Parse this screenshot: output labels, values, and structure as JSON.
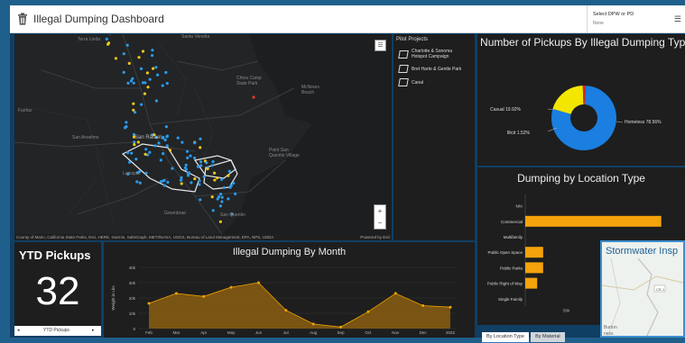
{
  "header": {
    "title": "Illegal Dumping Dashboard",
    "selector_label": "Select DPW or PD",
    "selector_value": "None",
    "menu_glyph": "☰"
  },
  "map": {
    "attribution": "County of Marin, California State Parks, Esri, HERE, Garmin, SafeGraph, METI/NASA, USGS, Bureau of Land Management, EPA, NPS, USDA",
    "powered": "Powered by Esri",
    "labels": [
      {
        "text": "Terra Linda",
        "id": "terra-linda"
      },
      {
        "text": "Santa Venetia",
        "id": "santa-venetia"
      },
      {
        "text": "Fairfax",
        "id": "fairfax"
      },
      {
        "text": "San Rafael",
        "id": "san-rafael"
      },
      {
        "text": "San Anselmo",
        "id": "san-anselmo"
      },
      {
        "text": "McNears Beach",
        "id": "mcnears-beach"
      },
      {
        "text": "China Camp State Park",
        "id": "china-camp"
      },
      {
        "text": "Greenbrae",
        "id": "greenbrae"
      },
      {
        "text": "San Quentin",
        "id": "san-quentin"
      },
      {
        "text": "Point San Quentin Village",
        "id": "pt-san-quentin"
      },
      {
        "text": "Larkspur",
        "id": "larkspur"
      }
    ],
    "zoom_in": "+",
    "zoom_out": "−"
  },
  "pilot": {
    "title": "Pilot Projects",
    "items": [
      "Charlotte & Sonoma Hotspot Campaign",
      "Bret Harte & Gentle Park",
      "Canal"
    ]
  },
  "pie": {
    "title": "Number of Pickups By Illegal Dumping Type",
    "slices": [
      {
        "label": "Homeless 78.56%",
        "value": 78.56,
        "color": "#1a7fe0"
      },
      {
        "label": "Casual 19.92%",
        "value": 19.92,
        "color": "#f3e600"
      },
      {
        "label": "Illicit 1.52%",
        "value": 1.52,
        "color": "#d32a1d"
      }
    ]
  },
  "bar": {
    "title": "Dumping by Location Type",
    "categories": [
      "N/A",
      "Commercial",
      "Multifamily",
      "Public Open Space",
      "Public Parks",
      "Public Right of Way",
      "Single Family"
    ],
    "values": [
      0,
      137,
      0,
      18,
      18,
      12,
      0
    ],
    "xtick": "50k",
    "tabs": [
      "By Location Type",
      "By Material"
    ]
  },
  "ytd": {
    "title": "YTD Pickups",
    "value": "32",
    "selector": "YTD Pickups",
    "prev": "◂",
    "next": "▸"
  },
  "month": {
    "title": "Illegal Dumping By Month",
    "ylabel": "Weight in Lbs",
    "yticks": [
      "40k",
      "30k",
      "20k",
      "10k",
      "0"
    ],
    "color": "#f0a400"
  },
  "storm": {
    "title": "Stormwater Insp",
    "map_labels": [
      "CR 1",
      "Burton",
      "ness"
    ]
  },
  "chart_data": [
    {
      "type": "pie",
      "title": "Number of Pickups By Illegal Dumping Type",
      "categories": [
        "Homeless",
        "Casual",
        "Illicit"
      ],
      "values": [
        78.56,
        19.92,
        1.52
      ]
    },
    {
      "type": "bar",
      "title": "Dumping by Location Type",
      "categories": [
        "N/A",
        "Commercial",
        "Multifamily",
        "Public Open Space",
        "Public Parks",
        "Public Right of Way",
        "Single Family"
      ],
      "values": [
        0,
        137,
        0,
        18,
        18,
        12,
        0
      ],
      "xlabel": "",
      "ylabel": ""
    },
    {
      "type": "area",
      "title": "Illegal Dumping By Month",
      "categories": [
        "Feb",
        "Mar",
        "Apr",
        "May",
        "Jun",
        "Jul",
        "Aug",
        "Sep",
        "Oct",
        "Nov",
        "Dec",
        "2022"
      ],
      "values": [
        16500,
        23000,
        21000,
        27000,
        30000,
        12000,
        3000,
        1000,
        11000,
        23000,
        15000,
        14000
      ],
      "ylabel": "Weight in Lbs",
      "ylim": [
        0,
        40000
      ],
      "yticks": [
        "40k",
        "30k",
        "20k",
        "10k",
        "0"
      ],
      "series": [
        {
          "values": [
            16500,
            23000,
            21000,
            27000,
            30000,
            12000,
            3000,
            1000,
            11000,
            23000,
            15000,
            14000
          ]
        }
      ]
    }
  ]
}
